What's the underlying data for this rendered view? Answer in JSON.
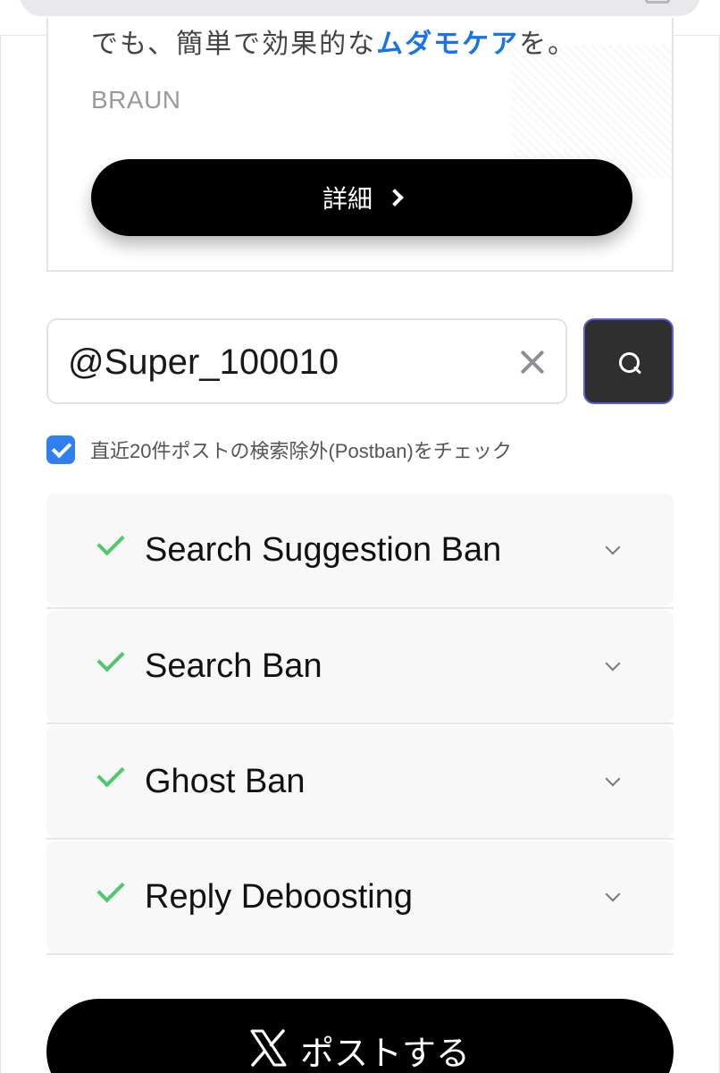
{
  "ad": {
    "headline_prefix": "でも、簡単で効果的な",
    "headline_highlight": "ムダモケア",
    "headline_suffix": "を。",
    "brand": "BRAUN",
    "details_button": "詳細"
  },
  "search": {
    "value": "@Super_100010"
  },
  "postban_checkbox": {
    "checked": true,
    "label": "直近20件ポストの検索除外(Postban)をチェック"
  },
  "results": [
    {
      "label": "Search Suggestion Ban",
      "status": "pass"
    },
    {
      "label": "Search Ban",
      "status": "pass"
    },
    {
      "label": "Ghost Ban",
      "status": "pass"
    },
    {
      "label": "Reply Deboosting",
      "status": "pass"
    }
  ],
  "post_button": {
    "label": "ポストする"
  },
  "colors": {
    "accent_blue": "#2f7ff0",
    "pass_green": "#4cc96b",
    "button_black": "#000000"
  },
  "icons": {
    "search": "search-icon",
    "clear": "close-icon",
    "result": "check-icon",
    "expand": "chevron-down-icon",
    "details": "chevron-right-icon",
    "post": "x-logo-icon"
  }
}
